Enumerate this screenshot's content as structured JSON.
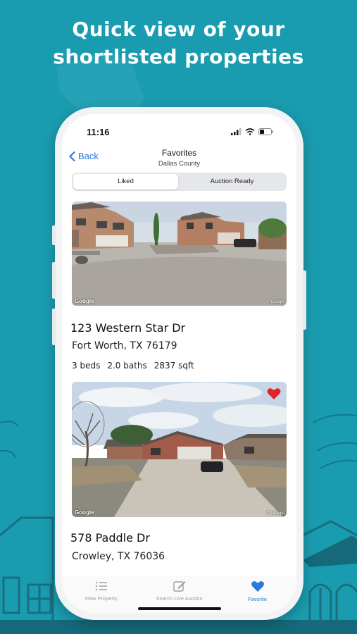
{
  "headline": {
    "line1": "Quick view of your",
    "line2": "shortlisted properties"
  },
  "colors": {
    "background": "#1a9cb0",
    "accent": "#2a78d8",
    "heart": "#e3232c"
  },
  "status_bar": {
    "time": "11:16",
    "icons": [
      "signal-icon",
      "wifi-icon",
      "battery-icon"
    ]
  },
  "nav": {
    "back_label": "Back",
    "title": "Favorites",
    "subtitle": "Dallas County"
  },
  "segments": {
    "liked": "Liked",
    "auction_ready": "Auction Ready",
    "selected": "Liked"
  },
  "listings": [
    {
      "address": "123 Western Star Dr",
      "city_state_zip": "Fort Worth, TX 76179",
      "beds": "3 beds",
      "baths": "2.0 baths",
      "sqft": "2837 sqft",
      "photo_credit": "Google",
      "photo_copyright": "© Google",
      "favorited": false
    },
    {
      "address": "578 Paddle Dr",
      "city_state_zip": "Crowley, TX 76036",
      "photo_credit": "Google",
      "photo_copyright": "© Google",
      "favorited": true
    }
  ],
  "tabbar": {
    "tabs": [
      {
        "label": "View Property",
        "icon": "list-icon"
      },
      {
        "label": "Search Live Auction",
        "icon": "edit-icon"
      },
      {
        "label": "Favorite",
        "icon": "heart-icon"
      }
    ],
    "active": "Favorite"
  }
}
